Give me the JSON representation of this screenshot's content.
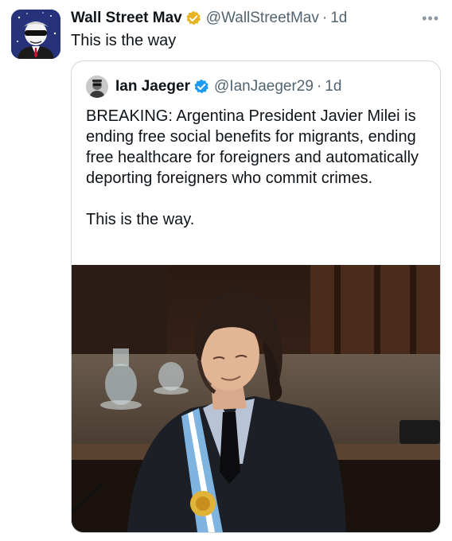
{
  "tweet": {
    "author_name": "Wall Street Mav",
    "author_handle": "@WallStreetMav",
    "separator": "·",
    "time": "1d",
    "text": "This is the way",
    "avatar_icon": "masked-cartoon-avatar",
    "verified_color": "#e8b321"
  },
  "quoted": {
    "author_name": "Ian Jaeger",
    "author_handle": "@IanJaeger29",
    "separator": "·",
    "time": "1d",
    "text": "BREAKING: Argentina President Javier Milei is ending free social benefits for migrants, ending free healthcare for foreigners and automatically deporting foreigners who commit crimes.\n\nThis is the way.",
    "verified_color": "#1d9bf0"
  },
  "more_icon": "more-options-icon",
  "more_glyph": "•••"
}
